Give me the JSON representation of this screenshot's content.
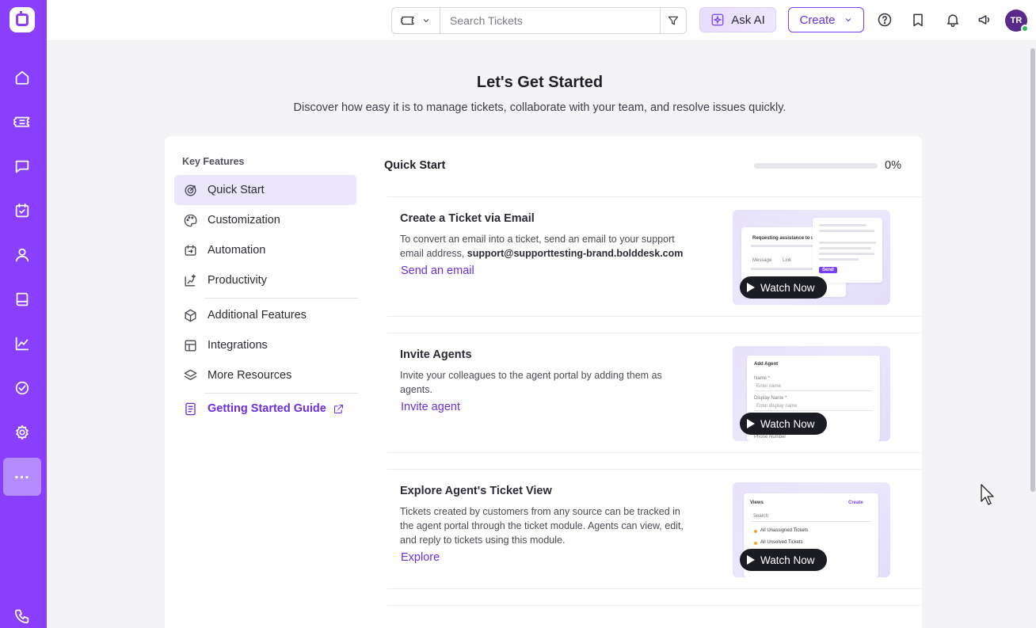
{
  "topbar": {
    "search_placeholder": "Search Tickets",
    "ask_ai_label": "Ask AI",
    "create_label": "Create",
    "avatar_initials": "TR"
  },
  "header": {
    "title": "Let's Get Started",
    "subtitle": "Discover how easy it is to manage tickets, collaborate with your team, and resolve issues quickly."
  },
  "sidebar": {
    "section_label": "Key Features",
    "items": [
      {
        "label": "Quick Start",
        "icon": "target-icon"
      },
      {
        "label": "Customization",
        "icon": "palette-icon"
      },
      {
        "label": "Automation",
        "icon": "automation-icon"
      },
      {
        "label": "Productivity",
        "icon": "productivity-icon"
      },
      {
        "label": "Additional Features",
        "icon": "cube-icon"
      },
      {
        "label": "Integrations",
        "icon": "integrations-icon"
      },
      {
        "label": "More Resources",
        "icon": "layers-icon"
      },
      {
        "label": "Getting Started Guide",
        "icon": "document-icon"
      }
    ]
  },
  "quick_start": {
    "title": "Quick Start",
    "progress_text": "0%",
    "progress_fraction": 0,
    "watch_label": "Watch Now",
    "features": [
      {
        "title": "Create a Ticket via Email",
        "desc": "To convert an email into a ticket, send an email to your support email address, ",
        "desc_bold": "support@supporttesting-brand.bolddesk.com",
        "link": "Send an email"
      },
      {
        "title": "Invite Agents",
        "desc": "Invite your colleagues to the agent portal by adding them as agents.",
        "desc_bold": "",
        "link": "Invite agent"
      },
      {
        "title": "Explore Agent's Ticket View",
        "desc": "Tickets created by customers from any source can be tracked in the agent portal through the ticket module. Agents can view, edit, and reply to tickets using this module.",
        "desc_bold": "",
        "link": "Explore"
      }
    ]
  },
  "thumbnails": {
    "email": {
      "title": "Requesting assistance to upd",
      "tab1": "Message",
      "tab2": "Link",
      "send": "Send"
    },
    "agent": {
      "title": "Add Agent",
      "field1": "Name *",
      "field1_ph": "Enter name",
      "field2": "Display Name *",
      "field2_ph": "Enter display name",
      "field3": "Phone Number"
    },
    "views": {
      "title": "Views",
      "create": "Create",
      "search": "Search",
      "item1": "All Unassigned Tickets",
      "item2": "All Unsolved Tickets"
    }
  },
  "colors": {
    "brand": "#8a3ffc",
    "accent": "#6b2de6"
  }
}
